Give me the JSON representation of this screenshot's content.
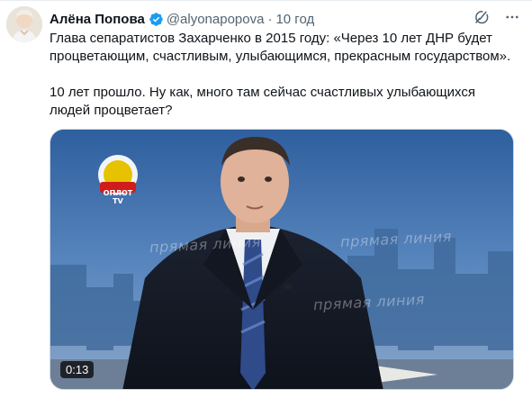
{
  "tweet": {
    "author_name": "Алёна Попова",
    "handle": "@alyonapopova",
    "separator": "·",
    "time": "10 год",
    "text_line1": "Глава сепаратистов Захарченко в 2015 году: «Через 10 лет ДНР будет процветающим, счастливым, улыбающимся, прекрасным государством».",
    "text_line2": "10 лет прошло. Ну как, много там сейчас счастливых улыбающихся людей процветает?"
  },
  "video": {
    "duration": "0:13",
    "channel_logo_text": "ОПЛОТ TV",
    "watermark_text": "прямая линия"
  },
  "icons": {
    "verified": "verified-badge-icon",
    "grok": "grok-icon",
    "more": "more-icon"
  },
  "colors": {
    "verified": "#1d9bf0",
    "secondary_text": "#536471"
  }
}
